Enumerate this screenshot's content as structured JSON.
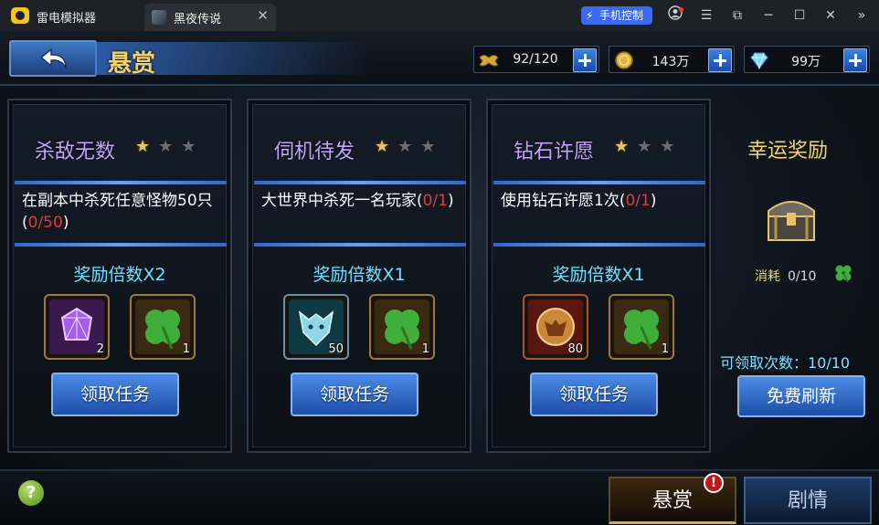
{
  "emulator": {
    "app_title": "雷电模拟器",
    "tab_label": "黑夜传说",
    "phone_control": "手机控制",
    "icons": [
      "user-icon",
      "menu-icon",
      "restore-icon",
      "minimize-icon",
      "maximize-icon",
      "close-icon",
      "expand-icon"
    ]
  },
  "header": {
    "title": "悬赏",
    "resources": [
      {
        "icon": "stamina-icon",
        "value": "92/120"
      },
      {
        "icon": "gold-coin-icon",
        "value": "143万"
      },
      {
        "icon": "diamond-icon",
        "value": "99万"
      }
    ]
  },
  "quests": [
    {
      "title": "杀敌无数",
      "stars_lit": 1,
      "stars_total": 3,
      "desc_prefix": "在副本中杀死任意怪物50只(",
      "progress": "0/50",
      "desc_suffix": ")",
      "multiplier": "奖励倍数X2",
      "rewards": [
        {
          "icon": "purple-gem-icon",
          "count": "2"
        },
        {
          "icon": "clover-icon",
          "count": "1"
        }
      ],
      "button": "领取任务"
    },
    {
      "title": "伺机待发",
      "stars_lit": 1,
      "stars_total": 3,
      "desc_prefix": "大世界中杀死一名玩家(",
      "progress": "0/1",
      "desc_suffix": ")",
      "multiplier": "奖励倍数X1",
      "rewards": [
        {
          "icon": "wolf-emblem-icon",
          "count": "50"
        },
        {
          "icon": "clover-icon",
          "count": "1"
        }
      ],
      "button": "领取任务"
    },
    {
      "title": "钻石许愿",
      "stars_lit": 1,
      "stars_total": 3,
      "desc_prefix": "使用钻石许愿1次(",
      "progress": "0/1",
      "desc_suffix": ")",
      "multiplier": "奖励倍数X1",
      "rewards": [
        {
          "icon": "beast-emblem-icon",
          "count": "80"
        },
        {
          "icon": "clover-icon",
          "count": "1"
        }
      ],
      "button": "领取任务"
    }
  ],
  "lucky": {
    "title": "幸运奖励",
    "cost_label": "消耗",
    "cost_value": "0/10",
    "claims": "可领取次数：10/10",
    "refresh_button": "免费刷新"
  },
  "bottom": {
    "help": "?",
    "tab_active": "悬赏",
    "tab_inactive": "剧情",
    "badge": "!"
  },
  "colors": {
    "accent_blue": "#3d82e0",
    "gold": "#f4d36a",
    "quest_title": "#c4a4ff",
    "multiplier": "#6fe0ff",
    "progress_red": "#e23b3b"
  }
}
